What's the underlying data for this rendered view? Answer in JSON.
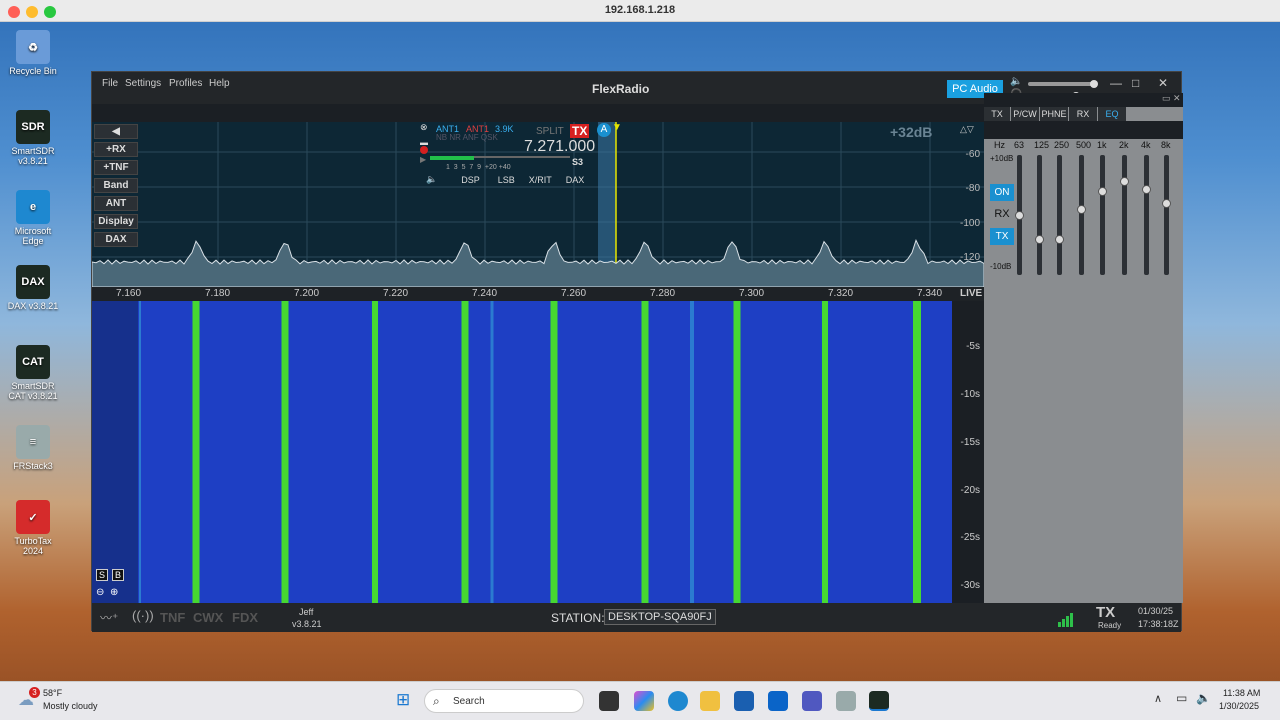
{
  "window": {
    "title": "192.168.1.218"
  },
  "desktop": {
    "icons": [
      {
        "label": "Recycle Bin",
        "glyph": "♻",
        "color": "#6a9bd8"
      },
      {
        "label": "SmartSDR v3.8.21",
        "glyph": "SDR",
        "color": "#1c2a22"
      },
      {
        "label": "Microsoft Edge",
        "glyph": "e",
        "color": "#1e88d0"
      },
      {
        "label": "DAX v3.8.21",
        "glyph": "DAX",
        "color": "#1c2a22"
      },
      {
        "label": "SmartSDR CAT v3.8.21",
        "glyph": "CAT",
        "color": "#1c2a22"
      },
      {
        "label": "FRStack3",
        "glyph": "≡",
        "color": "#9aa"
      },
      {
        "label": "TurboTax 2024",
        "glyph": "✓",
        "color": "#d52b2b"
      }
    ]
  },
  "app": {
    "menu": [
      "File",
      "Settings",
      "Profiles",
      "Help"
    ],
    "brand": "FlexRadio",
    "pc_audio": "PC Audio",
    "win_controls": [
      "—",
      "□",
      "✕"
    ],
    "side_buttons": [
      "+RX",
      "+TNF",
      "Band",
      "ANT",
      "Display",
      "DAX"
    ],
    "pan_gain": "+32dB",
    "db_scale": [
      "-60",
      "-80",
      "-100",
      "-120"
    ],
    "freq_ticks": [
      "7.160",
      "7.180",
      "7.200",
      "7.220",
      "7.240",
      "7.260",
      "7.280",
      "7.300",
      "7.320",
      "7.340"
    ],
    "live": "LIVE",
    "time_labels": [
      "-5s",
      "-10s",
      "-15s",
      "-20s",
      "-25s",
      "-30s"
    ],
    "slice": {
      "ant_rx": "ANT1",
      "ant_tx": "ANT1",
      "filter": "3.9K",
      "flags": "NB NR ANF QSK",
      "split": "SPLIT",
      "tx": "TX",
      "letter": "A",
      "frequency": "7.271.000",
      "smeter": "S3",
      "scale": "1  3  5  7  9  +20 +40",
      "tabs": [
        "DSP",
        "LSB",
        "X/RIT",
        "DAX"
      ]
    },
    "status": {
      "labels": [
        "TNF",
        "CWX",
        "FDX"
      ],
      "user": "Jeff",
      "version": "v3.8.21",
      "station_label": "STATION:",
      "station": "DESKTOP-SQA90FJ",
      "tx": "TX",
      "tx_state": "Ready",
      "date": "01/30/25",
      "time": "17:38:18Z",
      "sb": [
        "S",
        "B"
      ]
    },
    "eq": {
      "tabs": [
        "TX",
        "P/CW",
        "PHNE",
        "RX",
        "EQ"
      ],
      "hz": "Hz",
      "bands": [
        "63",
        "125",
        "250",
        "500",
        "1k",
        "2k",
        "4k",
        "8k"
      ],
      "levels": [
        0.5,
        0.3,
        0.3,
        0.55,
        0.7,
        0.78,
        0.72,
        0.6
      ],
      "top": "+10dB",
      "bottom": "-10dB",
      "on": "ON",
      "rx": "RX",
      "tx": "TX"
    }
  },
  "taskbar": {
    "weather_temp": "58°F",
    "weather_desc": "Mostly cloudy",
    "search": "Search",
    "clock_time": "11:38 AM",
    "clock_date": "1/30/2025",
    "badge": "3"
  }
}
